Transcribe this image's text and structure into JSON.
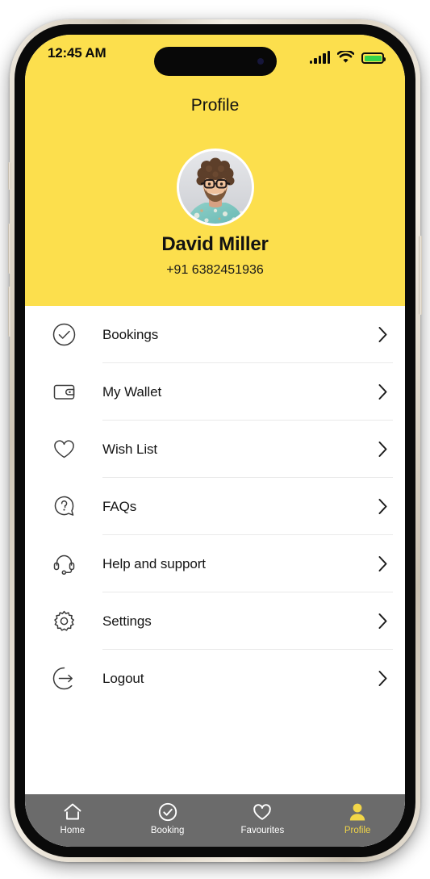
{
  "device": {
    "frame": "iphone-titanium",
    "frame_color": "#e4ddd0",
    "bezel_color": "#0a0a0a"
  },
  "statusbar": {
    "time": "12:45 AM",
    "signal_icon": "cellular-signal-icon",
    "signal_bars": 4,
    "wifi_icon": "wifi-icon",
    "battery_icon": "battery-icon",
    "battery_color": "#35d44a",
    "dynamic_island": "dynamic-island"
  },
  "header": {
    "title": "Profile",
    "background_color": "#fcdf4d",
    "avatar": {
      "icon": "user-avatar-photo",
      "alt": "Photo of a smiling man with curly brown hair, beard and dark glasses wearing a teal floral shirt"
    },
    "name": "David Miller",
    "phone": "+91 6382451936"
  },
  "menu": {
    "items": [
      {
        "label": "Bookings",
        "icon": "check-circle-icon",
        "chevron": "chevron-right-icon"
      },
      {
        "label": "My Wallet",
        "icon": "wallet-icon",
        "chevron": "chevron-right-icon"
      },
      {
        "label": "Wish List",
        "icon": "heart-icon",
        "chevron": "chevron-right-icon"
      },
      {
        "label": "FAQs",
        "icon": "question-bubble-icon",
        "chevron": "chevron-right-icon"
      },
      {
        "label": "Help and support",
        "icon": "headset-icon",
        "chevron": "chevron-right-icon"
      },
      {
        "label": "Settings",
        "icon": "gear-icon",
        "chevron": "chevron-right-icon"
      },
      {
        "label": "Logout",
        "icon": "logout-arrow-icon",
        "chevron": "chevron-right-icon"
      }
    ]
  },
  "bottom_nav": {
    "background_color": "#6b6b6b",
    "active_color": "#f2d648",
    "inactive_color": "#ffffff",
    "items": [
      {
        "label": "Home",
        "icon": "home-icon",
        "active": false
      },
      {
        "label": "Booking",
        "icon": "check-circle-icon",
        "active": false
      },
      {
        "label": "Favourites",
        "icon": "heart-icon",
        "active": false
      },
      {
        "label": "Profile",
        "icon": "person-icon",
        "active": true
      }
    ]
  }
}
